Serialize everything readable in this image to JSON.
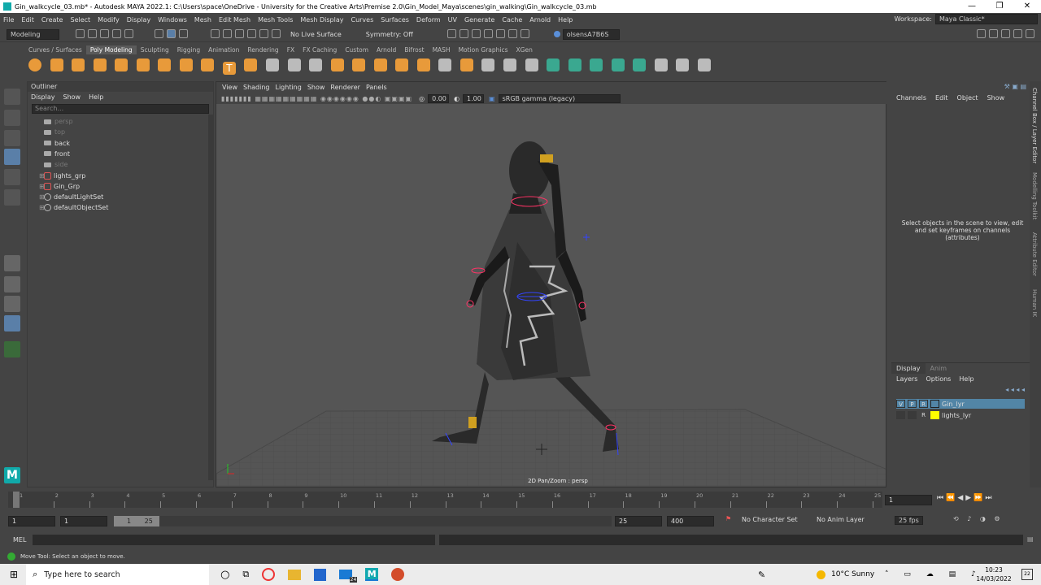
{
  "window": {
    "title": "Gin_walkcycle_03.mb* - Autodesk MAYA 2022.1: C:\\Users\\space\\OneDrive - University for the Creative Arts\\Premise 2.0\\Gin_Model_Maya\\scenes\\gin_walking\\Gin_walkcycle_03.mb",
    "minimize": "—",
    "restore": "❐",
    "close": "✕"
  },
  "menubar": {
    "items": [
      "File",
      "Edit",
      "Create",
      "Select",
      "Modify",
      "Display",
      "Windows",
      "Mesh",
      "Edit Mesh",
      "Mesh Tools",
      "Mesh Display",
      "Curves",
      "Surfaces",
      "Deform",
      "UV",
      "Generate",
      "Cache",
      "Arnold",
      "Help"
    ],
    "workspace_label": "Workspace:",
    "workspace_value": "Maya Classic*"
  },
  "statusline": {
    "menuset": "Modeling",
    "live_surface": "No Live Surface",
    "symmetry": "Symmetry: Off",
    "user": "olsensA7B6S"
  },
  "shelf": {
    "tabs": [
      "Curves / Surfaces",
      "Poly Modeling",
      "Sculpting",
      "Rigging",
      "Animation",
      "Rendering",
      "FX",
      "FX Caching",
      "Custom",
      "Arnold",
      "Bifrost",
      "MASH",
      "Motion Graphics",
      "XGen"
    ],
    "active": "Poly Modeling"
  },
  "outliner": {
    "title": "Outliner",
    "menus": [
      "Display",
      "Show",
      "Help"
    ],
    "search_placeholder": "Search...",
    "items": [
      {
        "label": "persp",
        "type": "camera",
        "dim": true
      },
      {
        "label": "top",
        "type": "camera",
        "dim": true
      },
      {
        "label": "back",
        "type": "camera",
        "dim": false
      },
      {
        "label": "front",
        "type": "camera",
        "dim": false
      },
      {
        "label": "side",
        "type": "camera",
        "dim": true
      },
      {
        "label": "lights_grp",
        "type": "group",
        "dim": false
      },
      {
        "label": "Gin_Grp",
        "type": "group",
        "dim": false
      },
      {
        "label": "defaultLightSet",
        "type": "set",
        "dim": false
      },
      {
        "label": "defaultObjectSet",
        "type": "set",
        "dim": false
      }
    ]
  },
  "viewport": {
    "menus": [
      "View",
      "Shading",
      "Lighting",
      "Show",
      "Renderer",
      "Panels"
    ],
    "exposure": "0.00",
    "gamma": "1.00",
    "colorspace": "sRGB gamma (legacy)",
    "hud": "2D Pan/Zoom : persp"
  },
  "channelbox": {
    "menus": [
      "Channels",
      "Edit",
      "Object",
      "Show"
    ],
    "message": "Select objects in the scene to view, edit and set keyframes on channels (attributes)"
  },
  "sidetabs": [
    "Channel Box / Layer Editor",
    "Modelling Toolkit",
    "Attribute Editor",
    "Human IK"
  ],
  "layereditor": {
    "tabs": [
      "Display",
      "Anim"
    ],
    "menus": [
      "Layers",
      "Options",
      "Help"
    ],
    "layers": [
      {
        "v": "V",
        "p": "P",
        "r": "R",
        "name": "Gin_lyr",
        "color": "#2b2b2b",
        "selected": true
      },
      {
        "v": "",
        "p": "",
        "r": "R",
        "name": "lights_lyr",
        "color": "#ffff00",
        "selected": false
      }
    ]
  },
  "timeslider": {
    "ticks": [
      "1",
      "2",
      "3",
      "4",
      "5",
      "6",
      "7",
      "8",
      "9",
      "10",
      "11",
      "12",
      "13",
      "14",
      "15",
      "16",
      "17",
      "18",
      "19",
      "20",
      "21",
      "22",
      "23",
      "24",
      "25"
    ],
    "current_frame": "1"
  },
  "rangeslider": {
    "start": "1",
    "playback_start": "1",
    "range_start": "1",
    "range_end": "25",
    "playback_end": "25",
    "end": "400",
    "char_set": "No Character Set",
    "anim_layer": "No Anim Layer",
    "fps": "25 fps"
  },
  "cmdline": {
    "label": "MEL"
  },
  "helpline": {
    "text": "Move Tool: Select an object to move."
  },
  "taskbar": {
    "search": "Type here to search",
    "weather": "10°C  Sunny",
    "time": "10:23",
    "date": "14/03/2022",
    "notifications": "22",
    "mail_badge": "24"
  }
}
